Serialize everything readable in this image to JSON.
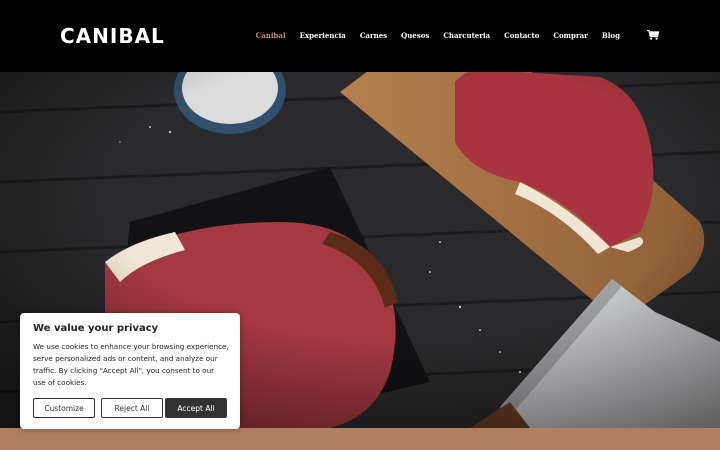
{
  "header": {
    "logo": "CANIBAL",
    "nav": [
      "Canibal",
      "Experiencia",
      "Carnes",
      "Quesos",
      "Charcuteria",
      "Contacto",
      "Comprar",
      "Blog"
    ],
    "active_nav": "Canibal",
    "cart_icon": "shopping-cart-icon"
  },
  "cookie": {
    "title": "We value your privacy",
    "text": "We use cookies to enhance your browsing experience, serve personalized ads or content, and analyze our traffic. By clicking \"Accept All\", you consent to our use of cookies.",
    "customize": "Customize",
    "reject": "Reject All",
    "accept": "Accept All"
  },
  "colors": {
    "accent": "#c9906d",
    "strip": "#b07f62",
    "button_dark": "#333333"
  }
}
